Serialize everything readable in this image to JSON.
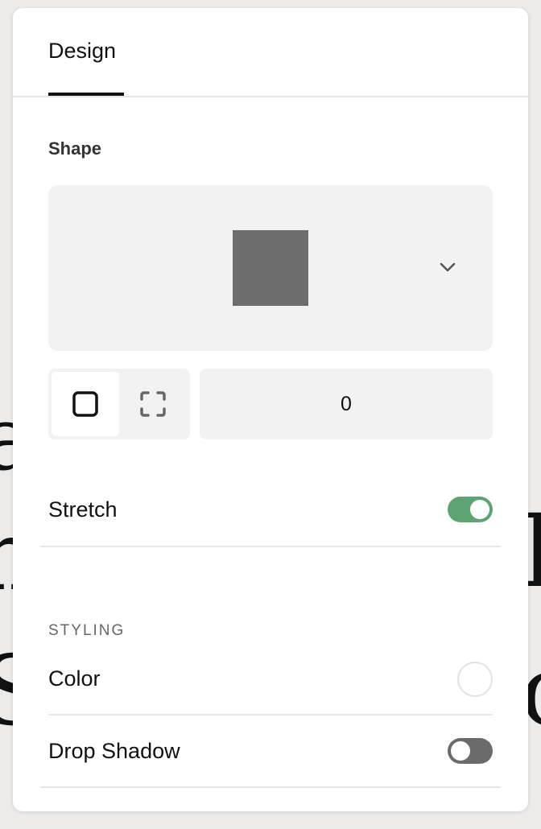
{
  "tabs": {
    "design_label": "Design"
  },
  "shape": {
    "section_label": "Shape",
    "selected_shape": "square",
    "preview_color": "#6d6d6d",
    "dropdown_icon": "chevron-down-icon",
    "corner_modes": [
      "all-corners",
      "individual-corners"
    ],
    "corner_mode_selected": "all-corners",
    "corner_radius": "0"
  },
  "stretch": {
    "label": "Stretch",
    "enabled": true,
    "toggle_color": "#5ea372"
  },
  "styling": {
    "heading": "STYLING",
    "color_label": "Color",
    "color_value": "#ffffff",
    "drop_shadow_label": "Drop Shadow",
    "drop_shadow_enabled": false
  }
}
